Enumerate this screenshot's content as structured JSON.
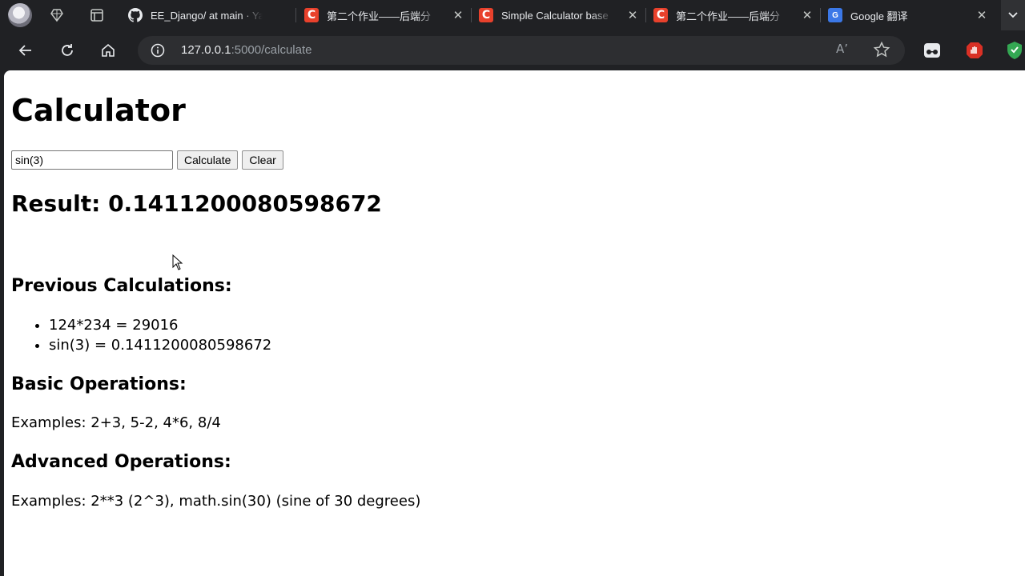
{
  "tabs": [
    {
      "title": "EE_Django/ at main · Ya",
      "favicon": "github-icon"
    },
    {
      "title": "第二个作业——后端分",
      "favicon": "csdn-icon"
    },
    {
      "title": "Simple Calculator base",
      "favicon": "csdn-icon"
    },
    {
      "title": "第二个作业——后端分",
      "favicon": "csdn-icon"
    },
    {
      "title": "Google 翻译",
      "favicon": "google-translate-icon"
    }
  ],
  "favicon_letters": {
    "csdn": "C",
    "gt": "G"
  },
  "address_bar": {
    "host": "127.0.0.1",
    "path": ":5000/calculate",
    "read_aloud": "Aʼ"
  },
  "page": {
    "title": "Calculator",
    "input_value": "sin(3)",
    "calculate_label": "Calculate",
    "clear_label": "Clear",
    "result_text": "Result: 0.1411200080598672",
    "previous_heading": "Previous Calculations:",
    "history": [
      "124*234 = 29016",
      "sin(3) = 0.1411200080598672"
    ],
    "basic_heading": "Basic Operations:",
    "basic_examples": "Examples: 2+3, 5-2, 4*6, 8/4",
    "advanced_heading": "Advanced Operations:",
    "advanced_examples": "Examples: 2**3 (2^3), math.sin(30) (sine of 30 degrees)"
  },
  "colors": {
    "chrome_bg": "#202124",
    "omnibox_bg": "#2d2e31",
    "csdn_red": "#e8412c",
    "ext_shield": "#34a853",
    "ext_red": "#d93025"
  }
}
